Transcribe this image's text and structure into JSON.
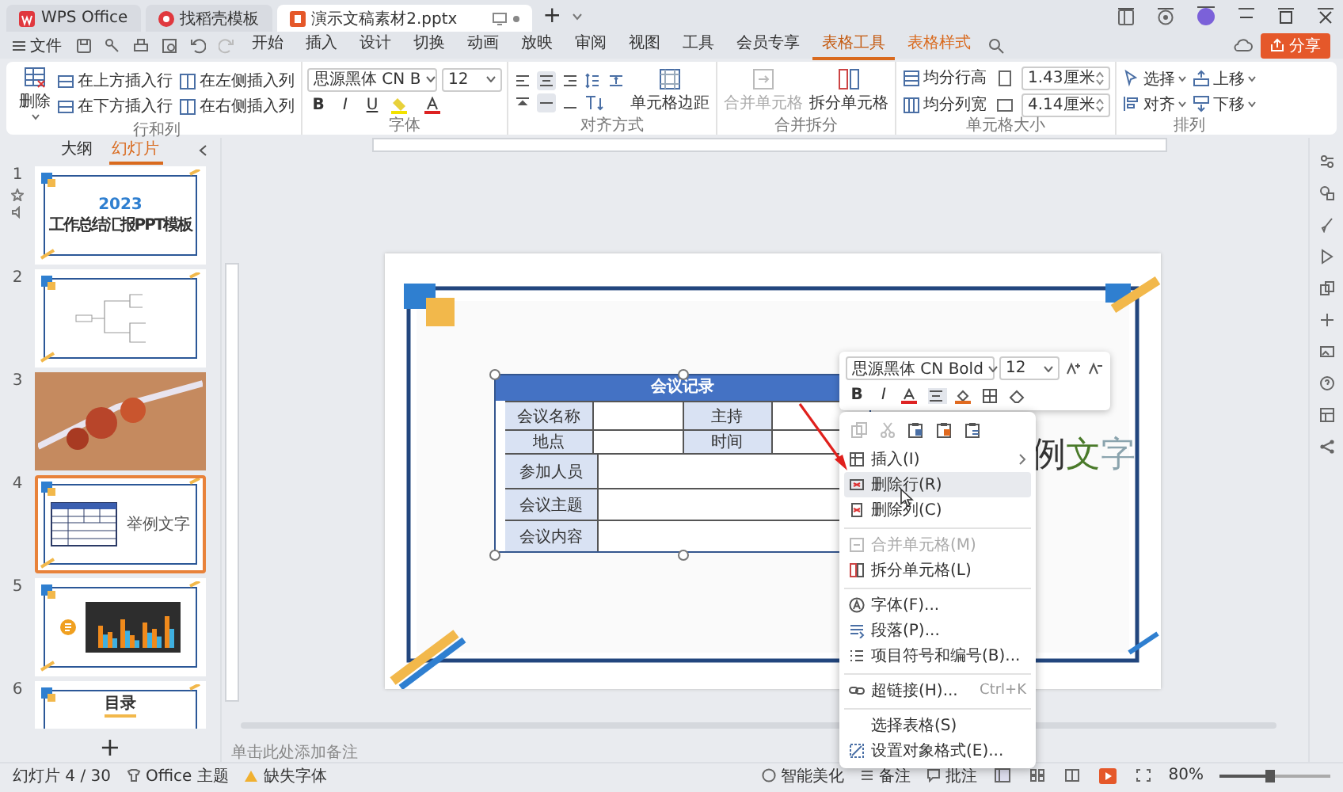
{
  "window": {
    "tabs": [
      {
        "label": "WPS Office",
        "selected": false,
        "kind": "home"
      },
      {
        "label": "找稻壳模板",
        "selected": false,
        "kind": "template"
      },
      {
        "label": "演示文稿素材2.pptx",
        "selected": true,
        "kind": "doc"
      }
    ],
    "new_tab": "+"
  },
  "menu": {
    "file": "文件",
    "tabs": [
      {
        "label": "开始",
        "selected": false,
        "contextual": false
      },
      {
        "label": "插入",
        "selected": false,
        "contextual": false
      },
      {
        "label": "设计",
        "selected": false,
        "contextual": false
      },
      {
        "label": "切换",
        "selected": false,
        "contextual": false
      },
      {
        "label": "动画",
        "selected": false,
        "contextual": false
      },
      {
        "label": "放映",
        "selected": false,
        "contextual": false
      },
      {
        "label": "审阅",
        "selected": false,
        "contextual": false
      },
      {
        "label": "视图",
        "selected": false,
        "contextual": false
      },
      {
        "label": "工具",
        "selected": false,
        "contextual": false
      },
      {
        "label": "会员专享",
        "selected": false,
        "contextual": false
      },
      {
        "label": "表格工具",
        "selected": true,
        "contextual": true
      },
      {
        "label": "表格样式",
        "selected": false,
        "contextual": true
      }
    ],
    "share": "分享"
  },
  "ribbon": {
    "groups": [
      {
        "kind": "rows_cols",
        "label": "行和列",
        "delete": "删除",
        "items": [
          "在上方插入行",
          "在下方插入行",
          "在左侧插入列",
          "在右侧插入列"
        ]
      },
      {
        "kind": "font",
        "label": "字体",
        "font": "思源黑体 CN B",
        "size": "12",
        "styles": [
          "B",
          "I",
          "U"
        ]
      },
      {
        "kind": "align",
        "label": "对齐方式",
        "margin": "单元格边距"
      },
      {
        "kind": "merge",
        "label": "合并拆分",
        "items": [
          {
            "label": "合并单元格",
            "disabled": true
          },
          {
            "label": "拆分单元格",
            "disabled": false
          }
        ]
      },
      {
        "kind": "size",
        "label": "单元格大小",
        "items": [
          {
            "label": "均分行高",
            "value": "1.43厘米"
          },
          {
            "label": "均分列宽",
            "value": "4.14厘米"
          }
        ]
      },
      {
        "kind": "arrange",
        "label": "排列",
        "items": [
          "选择",
          "对齐",
          "上移",
          "下移"
        ]
      }
    ]
  },
  "panel": {
    "tabs": [
      {
        "label": "大纲",
        "selected": false
      },
      {
        "label": "幻灯片",
        "selected": true
      }
    ],
    "slides": [
      {
        "number": "1",
        "kind": "title",
        "selected": false,
        "year": "2023",
        "title": "工作总结汇报PPT模板"
      },
      {
        "number": "2",
        "kind": "mindmap",
        "selected": false
      },
      {
        "number": "3",
        "kind": "photo",
        "selected": false
      },
      {
        "number": "4",
        "kind": "table",
        "selected": true,
        "text": "举例文字"
      },
      {
        "number": "5",
        "kind": "chart",
        "selected": false
      },
      {
        "number": "6",
        "kind": "contents",
        "selected": false,
        "text": "目录"
      }
    ],
    "add": "+"
  },
  "slide": {
    "table": {
      "title": "会议记录",
      "rows": [
        {
          "label": "会议名称",
          "pair_label": "主持"
        },
        {
          "label": "地点",
          "pair_label": "时间"
        },
        {
          "label": "参加人员"
        },
        {
          "label": "会议主题"
        },
        {
          "label": "会议内容"
        }
      ]
    },
    "text": "例文字"
  },
  "mini_toolbar": {
    "font": "思源黑体 CN Bold",
    "size": "12",
    "styles": [
      "B",
      "I"
    ]
  },
  "context_menu": {
    "items": [
      {
        "label": "插入(I)",
        "submenu": true,
        "disabled": false,
        "selected": false
      },
      {
        "label": "删除行(R)",
        "disabled": false,
        "selected": true
      },
      {
        "label": "删除列(C)",
        "disabled": false,
        "selected": false
      },
      {
        "label": "合并单元格(M)",
        "disabled": true,
        "selected": false,
        "divider_before": true
      },
      {
        "label": "拆分单元格(L)",
        "disabled": false,
        "selected": false
      },
      {
        "label": "字体(F)...",
        "disabled": false,
        "selected": false,
        "divider_before": true
      },
      {
        "label": "段落(P)...",
        "disabled": false,
        "selected": false
      },
      {
        "label": "项目符号和编号(B)...",
        "disabled": false,
        "selected": false
      },
      {
        "label": "超链接(H)...",
        "shortcut": "Ctrl+K",
        "disabled": false,
        "selected": false,
        "divider_before": true
      },
      {
        "label": "选择表格(S)",
        "disabled": false,
        "selected": false,
        "divider_before": true
      },
      {
        "label": "设置对象格式(E)...",
        "disabled": false,
        "selected": false
      }
    ]
  },
  "notes": {
    "placeholder": "单击此处添加备注"
  },
  "status_bar": {
    "slide": "幻灯片 4 / 30",
    "theme": "Office 主题",
    "missing_font": "缺失字体",
    "beautify": "智能美化",
    "notes": "备注",
    "comments": "批注",
    "zoom": "80%",
    "level": 0.45
  }
}
